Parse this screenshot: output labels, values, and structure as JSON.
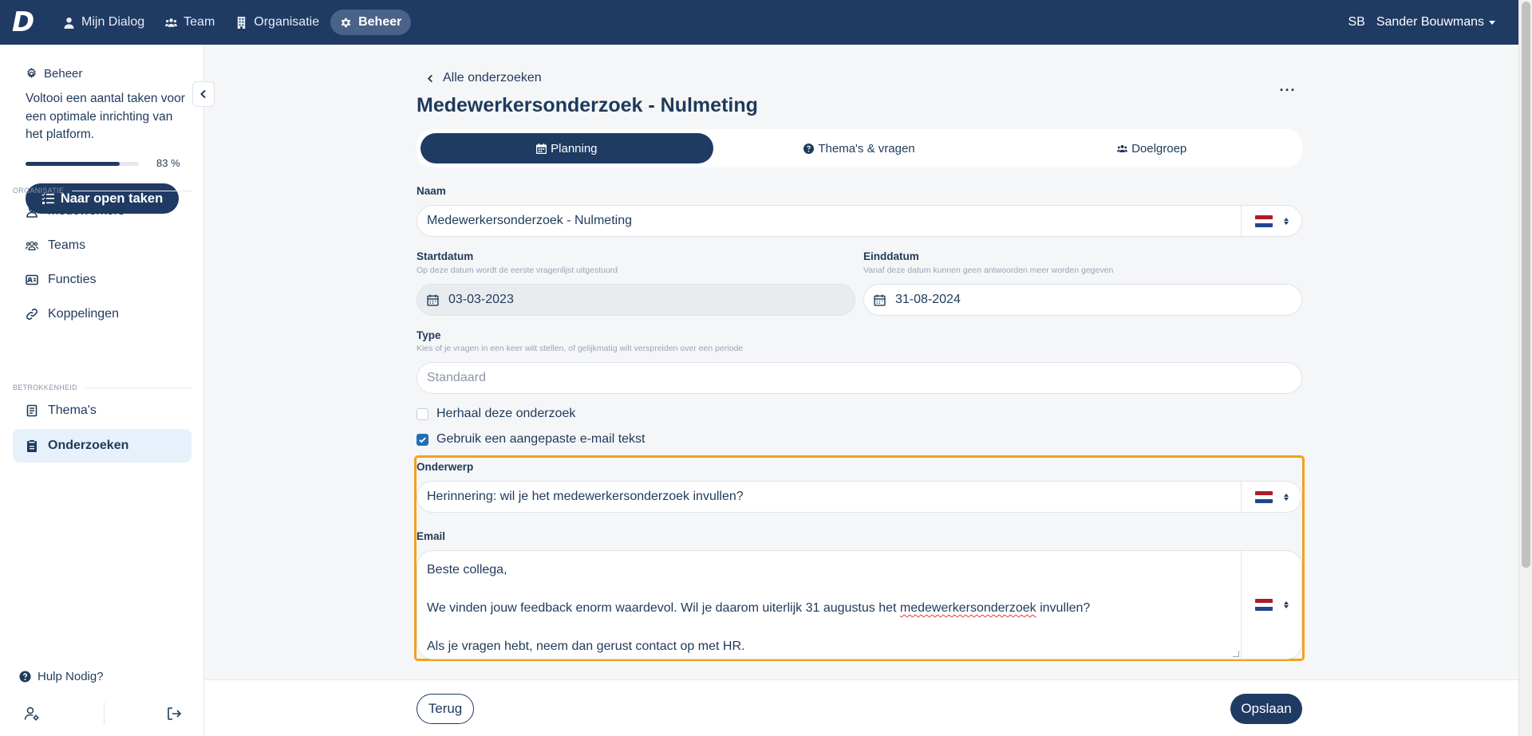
{
  "nav": {
    "items": [
      {
        "label": "Mijn Dialog",
        "icon": "user-icon"
      },
      {
        "label": "Team",
        "icon": "users-icon"
      },
      {
        "label": "Organisatie",
        "icon": "building-icon"
      },
      {
        "label": "Beheer",
        "icon": "gear-icon",
        "active": true
      }
    ],
    "initials": "SB",
    "user_name": "Sander Bouwmans"
  },
  "sidebar": {
    "header": "Beheer",
    "intro": "Voltooi een aantal taken voor een optimale inrichting van het platform.",
    "progress_value": 0.83,
    "progress_label": "83 %",
    "open_tasks_button": "Naar open taken",
    "section_org": "ORGANISATIE",
    "section_engagement": "BETROKKENHEID",
    "items": [
      {
        "label": "Medewerkers",
        "icon": "user-icon"
      },
      {
        "label": "Teams",
        "icon": "users-icon"
      },
      {
        "label": "Functies",
        "icon": "id-card-icon"
      },
      {
        "label": "Koppelingen",
        "icon": "link-icon"
      },
      {
        "label": "Thema's",
        "icon": "book-icon"
      },
      {
        "label": "Onderzoeken",
        "icon": "clipboard-icon",
        "active": true
      }
    ],
    "help": "Hulp Nodig?"
  },
  "main": {
    "back_link": "Alle onderzoeken",
    "title": "Medewerkersonderzoek - Nulmeting",
    "more": "···",
    "tabs": [
      {
        "label": "Planning",
        "icon": "calendar-icon",
        "active": true
      },
      {
        "label": "Thema's & vragen",
        "icon": "question-circle-icon"
      },
      {
        "label": "Doelgroep",
        "icon": "users-icon"
      }
    ],
    "name_label": "Naam",
    "name_value": "Medewerkersonderzoek - Nulmeting",
    "start_label": "Startdatum",
    "start_hint": "Op deze datum wordt de eerste vragenlijst uitgestuurd",
    "start_value": "03-03-2023",
    "end_label": "Einddatum",
    "end_hint": "Vanaf deze datum kunnen geen antwoorden meer worden gegeven",
    "end_value": "31-08-2024",
    "type_label": "Type",
    "type_hint": "Kies of je vragen in een keer wilt stellen, of gelijkmatig wilt verspreiden over een periode",
    "type_placeholder": "Standaard",
    "repeat_label": "Herhaal deze onderzoek",
    "repeat_checked": false,
    "custom_email_label": "Gebruik een aangepaste e-mail tekst",
    "custom_email_checked": true,
    "subject_label": "Onderwerp",
    "subject_value": "Herinnering: wil je het medewerkersonderzoek invullen?",
    "email_label": "Email",
    "email_line1": "Beste collega,",
    "email_line2_a": "We vinden jouw feedback enorm waardevol. Wil je daarom uiterlijk 31 augustus het ",
    "email_line2_b": "medewerkersonderzoek",
    "email_line2_c": " invullen?",
    "email_line3": "Als je vragen hebt, neem dan gerust contact op met HR.",
    "language_flag": "NL"
  },
  "footer": {
    "back_button": "Terug",
    "save_button": "Opslaan"
  },
  "colors": {
    "primary": "#1f3a63",
    "highlight": "#f2a21b",
    "active_bg": "#e7f1fb",
    "flag_red": "#ae1c28",
    "flag_blue": "#21468b"
  }
}
